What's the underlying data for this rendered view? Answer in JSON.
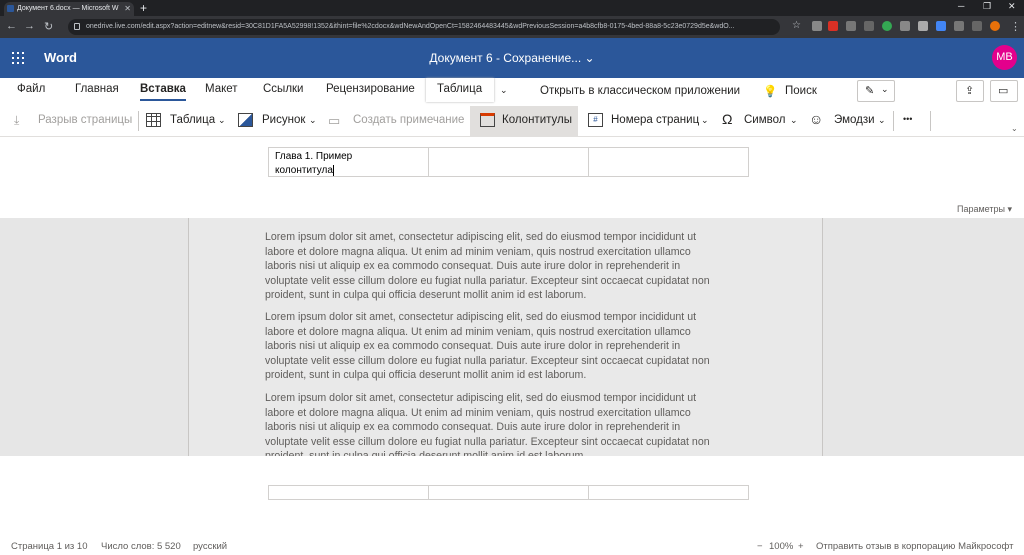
{
  "browser": {
    "tab_title": "Документ 6.docx — Microsoft W",
    "url": "onedrive.live.com/edit.aspx?action=editnew&resid=30C81D1FA5A52998!1352&ithint=file%2cdocx&wdNewAndOpenCt=1582464483445&wdPreviousSession=a4b8cfb8-0175-4bed-88a8-5c23e0729d5e&wdO..."
  },
  "app": {
    "name": "Word",
    "doc_title": "Документ 6  -  Сохранение...",
    "avatar": "MB"
  },
  "menu": {
    "file": "Файл",
    "home": "Главная",
    "insert": "Вставка",
    "layout": "Макет",
    "links": "Ссылки",
    "review": "Рецензирование",
    "table": "Таблица",
    "open_desktop": "Открыть в классическом приложении",
    "search": "Поиск"
  },
  "ribbon": {
    "page_break": "Разрыв страницы",
    "table": "Таблица",
    "picture": "Рисунок",
    "comment": "Создать примечание",
    "headers": "Колонтитулы",
    "page_numbers": "Номера страниц",
    "symbol": "Символ",
    "emoji": "Эмодзи",
    "more": "•••"
  },
  "header": {
    "line1": "Глава 1. Пример",
    "line2": "колонтитула"
  },
  "params": "Параметры",
  "body": {
    "p1": "Lorem ipsum dolor sit amet, consectetur adipiscing elit, sed do eiusmod tempor incididunt ut",
    "p2": "labore et dolore magna aliqua. Ut enim ad minim veniam, quis nostrud exercitation ullamco",
    "p3": "laboris nisi ut aliquip ex ea commodo consequat. Duis aute irure dolor in reprehenderit in",
    "p4": "voluptate velit esse cillum dolore eu fugiat nulla pariatur. Excepteur sint occaecat cupidatat non",
    "p5": "proident, sunt in culpa qui officia deserunt mollit anim id est laborum."
  },
  "status": {
    "page": "Страница 1 из 10",
    "words": "Число слов: 5 520",
    "lang": "русский",
    "zoom_minus": "−",
    "zoom": "100%",
    "zoom_plus": "+",
    "feedback": "Отправить отзыв в корпорацию Майкрософт"
  },
  "colors": {
    "brand": "#2b579a",
    "avatar": "#e3008c"
  }
}
